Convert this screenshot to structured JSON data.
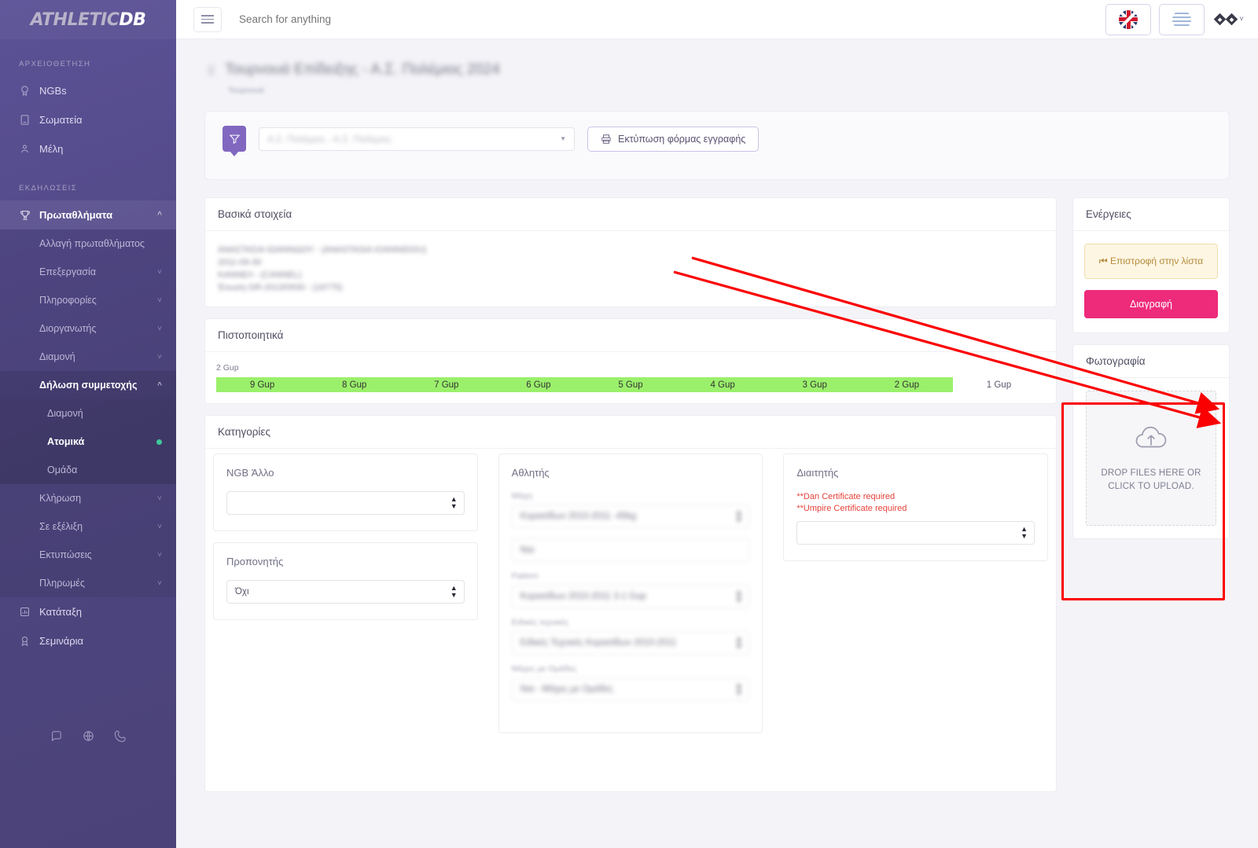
{
  "brand": {
    "name_1": "ATHLETIC",
    "name_2": "DB"
  },
  "topbar": {
    "search_placeholder": "Search for anything",
    "menu_icon": "hamburger-icon",
    "lang_flag": "uk-flag-icon",
    "region_flag": "greece-flag-icon",
    "user_chevron": "chevron-down-icon"
  },
  "sidebar": {
    "sections": [
      {
        "title": "ΑΡΧΕΙΟΘΕΤΗΣΗ"
      },
      {
        "title": "ΕΚΔΗΛΩΣΕΙΣ"
      }
    ],
    "archive_items": [
      {
        "label": "NGBs",
        "icon": "medal-icon"
      },
      {
        "label": "Σωματεία",
        "icon": "building-icon"
      },
      {
        "label": "Μέλη",
        "icon": "person-pin-icon"
      }
    ],
    "events_parent": {
      "label": "Πρωταθλήματα",
      "icon": "trophy-icon",
      "chevron": "chevron-up-icon"
    },
    "championship_items": [
      {
        "label": "Αλλαγή πρωταθλήματος",
        "chevron": ""
      },
      {
        "label": "Επεξεργασία",
        "chevron": "chevron-down-icon"
      },
      {
        "label": "Πληροφορίες",
        "chevron": "chevron-down-icon"
      },
      {
        "label": "Διοργανωτής",
        "chevron": "chevron-down-icon"
      },
      {
        "label": "Διαμονή",
        "chevron": "chevron-down-icon"
      }
    ],
    "participation": {
      "label": "Δήλωση συμμετοχής",
      "chevron": "chevron-up-icon"
    },
    "participation_items": [
      {
        "label": "Διαμονή",
        "active": false
      },
      {
        "label": "Ατομικά",
        "active": true
      },
      {
        "label": "Ομάδα",
        "active": false
      }
    ],
    "tail_items": [
      {
        "label": "Κλήρωση",
        "chevron": "chevron-down-icon"
      },
      {
        "label": "Σε εξέλιξη",
        "chevron": "chevron-down-icon"
      },
      {
        "label": "Εκτυπώσεις",
        "chevron": "chevron-down-icon"
      },
      {
        "label": "Πληρωμές",
        "chevron": "chevron-down-icon"
      }
    ],
    "bottom_items": [
      {
        "label": "Κατάταξη",
        "icon": "bar-chart-icon"
      },
      {
        "label": "Σεμινάρια",
        "icon": "award-icon"
      }
    ],
    "footer_icons": [
      "chat-icon",
      "globe-icon",
      "phone-icon"
    ]
  },
  "page": {
    "title": "Τουρνουά Επίδειξης - Α.Σ. Πολέμιος 2024",
    "subtitle": "Τουρνουά",
    "title_icon": "trophy-icon"
  },
  "filter": {
    "funnel_icon": "filter-icon",
    "select_value": "Α.Σ. Πολέμιος - Α.Σ. Πολέμιος",
    "print_button": "Εκτύπωση φόρμας εγγραφής",
    "print_icon": "printer-icon"
  },
  "basic_info": {
    "title": "Βασικά στοιχεία",
    "lines": [
      "ΑΝΑΣΤΑΣΙΑ ΙΩΑΝΝΙΔΟΥ - (ANASTASIA IOANNIDOU)",
      "2011-09-30",
      "ΚΑΝΝΕΛ - (CANNEL)",
      "Ένωση GR-2013/0930 - (16775)"
    ]
  },
  "certificates": {
    "title": "Πιστοποιητικά",
    "current_label": "2 Gup",
    "segments": [
      {
        "label": "9 Gup",
        "achieved": true
      },
      {
        "label": "8 Gup",
        "achieved": true
      },
      {
        "label": "7 Gup",
        "achieved": true
      },
      {
        "label": "6 Gup",
        "achieved": true
      },
      {
        "label": "5 Gup",
        "achieved": true
      },
      {
        "label": "4 Gup",
        "achieved": true
      },
      {
        "label": "3 Gup",
        "achieved": true
      },
      {
        "label": "2 Gup",
        "achieved": true
      },
      {
        "label": "1 Gup",
        "achieved": false
      }
    ]
  },
  "categories": {
    "title": "Κατηγορίες",
    "ngb_other": {
      "label": "NGB Άλλο",
      "value": ""
    },
    "coach": {
      "label": "Προπονητής",
      "value": "Όχι"
    },
    "athlete": {
      "title": "Αθλητής",
      "fields": [
        {
          "label": "Μάχη",
          "value": "Κορασίδων 2010-2011 -45kg"
        },
        {
          "label": "",
          "value": "Ναι"
        },
        {
          "label": "Pattern",
          "value": "Κορασίδων 2010-2011 3-1 Gup"
        },
        {
          "label": "Ειδικές τεχνικές",
          "value": "Ειδικές Τεχνικές Κορασίδων 2010-2011"
        },
        {
          "label": "Μάχες με Ομάδες",
          "value": "Ναι - Μάχες με Ομάδες"
        }
      ]
    },
    "referee": {
      "title": "Διαιτητής",
      "warnings": [
        "**Dan Certificate required",
        "**Umpire Certificate required"
      ],
      "value": ""
    }
  },
  "actions": {
    "title": "Ενέργειες",
    "back_button": "Επιστροφή στην λίστα",
    "back_icon": "skip-back-icon",
    "delete_button": "Διαγραφή"
  },
  "photo": {
    "title": "Φωτογραφία",
    "dropzone_icon": "cloud-upload-icon",
    "dropzone_text_line1": "DROP FILES HERE OR",
    "dropzone_text_line2": "CLICK TO UPLOAD."
  },
  "annotation": {
    "highlight_color": "#fb0000",
    "arrow_count": 2
  }
}
